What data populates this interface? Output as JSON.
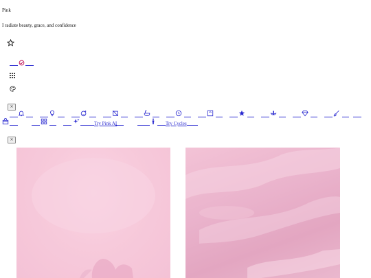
{
  "header": {
    "brand": "Pink",
    "tagline": "I radiate beauty, grace, and confidence"
  },
  "icons": {
    "star": "star-outline-icon",
    "no_sign": "circle-slash-icon",
    "grid": "grid-icon",
    "palette": "palette-icon"
  },
  "toolbar": {
    "close_label": "×",
    "links": {
      "try_pink_ai": "Try Pink AI",
      "try_cycles": "Try Cycles"
    }
  },
  "second_close_label": "×",
  "colors": {
    "accent": "#2a2ad0",
    "pink": "#c2185b",
    "card_pink_1": "#f6c9dc",
    "card_pink_2": "#eab3cc"
  }
}
